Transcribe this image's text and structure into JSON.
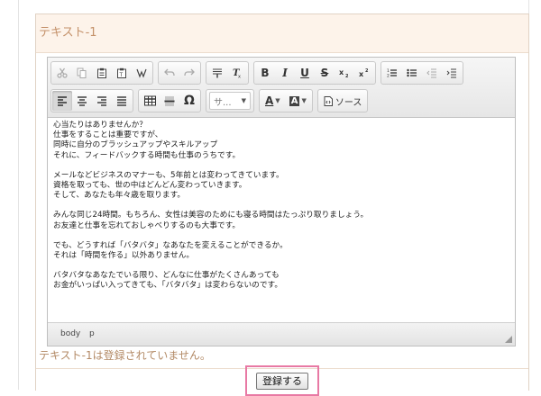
{
  "form": {
    "field_title": "テキスト-1",
    "notice": "テキスト-1は登録されていません。",
    "submit_label": "登録する"
  },
  "editor": {
    "toolbar": {
      "format_combo": "サ...",
      "source_label": "ソース",
      "buttons_row1": [
        "cut-icon",
        "copy-icon",
        "paste-icon",
        "paste-text-icon",
        "paste-word-icon",
        "undo-icon",
        "redo-icon",
        "clear-formatting-block-icon",
        "remove-format-icon",
        "bold-icon",
        "italic-icon",
        "underline-icon",
        "strikethrough-icon",
        "subscript-icon",
        "superscript-icon",
        "numbered-list-icon",
        "bulleted-list-icon",
        "outdent-icon",
        "indent-icon"
      ],
      "buttons_row2": [
        "align-left-icon",
        "align-center-icon",
        "align-right-icon",
        "justify-icon",
        "table-icon",
        "horizontal-rule-icon",
        "special-char-icon",
        "text-color-icon",
        "background-color-icon",
        "source-icon"
      ],
      "bold_glyph": "B",
      "italic_glyph": "I",
      "underline_glyph": "U",
      "strike_glyph": "S",
      "omega_glyph": "Ω",
      "text_color_glyph": "A",
      "bg_color_glyph": "A"
    },
    "paragraphs": [
      [
        "心当たりはありませんか？",
        "仕事をすることは重要ですが、",
        "同時に自分のブラッシュアップやスキルアップ",
        "それに、フィードバックする時間も仕事のうちです。"
      ],
      [
        "メールなどビジネスのマナーも、5年前とは変わってきています。",
        "資格を取っても、世の中はどんどん変わっていきます。",
        "そして、あなたも年々歳を取ります。"
      ],
      [
        "みんな同じ24時間。もちろん、女性は美容のためにも寝る時間はたっぷり取りましょう。",
        "お友達と仕事を忘れておしゃべりするのも大事です。"
      ],
      [
        "でも、どうすれば「バタバタ」なあなたを変えることができるか。",
        "それは「時間を作る」以外ありません。"
      ],
      [
        "バタバタなあなたでいる限り、どんなに仕事がたくさんあっても",
        "お金がいっぱい入ってきても、「バタバタ」は変わらないのです。"
      ]
    ],
    "statusbar": {
      "path": [
        "body",
        "p"
      ]
    }
  },
  "colors": {
    "accent_text": "#c4916a",
    "header_bg": "#fdf3ea",
    "highlight_border": "#e879a4"
  }
}
